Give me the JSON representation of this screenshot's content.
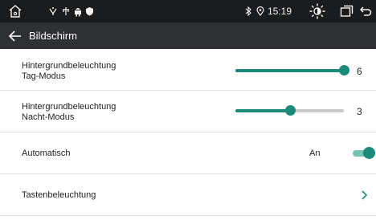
{
  "status_bar": {
    "time": "15:19",
    "icons": [
      "home-icon",
      "usb-icon",
      "gps-icon",
      "android-icon",
      "shield-icon",
      "bluetooth-icon",
      "location-icon",
      "brightness-icon",
      "recent-apps-icon",
      "back-icon"
    ]
  },
  "header": {
    "title": "Bildschirm"
  },
  "settings": {
    "day_backlight": {
      "label_line1": "Hintergrundbeleuchtung",
      "label_line2": "Tag-Modus",
      "value": "6",
      "level": 1.0
    },
    "night_backlight": {
      "label_line1": "Hintergrundbeleuchtung",
      "label_line2": "Nacht-Modus",
      "value": "3",
      "level": 0.5
    },
    "automatic": {
      "label": "Automatisch",
      "state_label": "An",
      "on": true
    },
    "key_lighting": {
      "label": "Tastenbeleuchtung"
    }
  },
  "colors": {
    "accent": "#1c8a7a",
    "status_bar_bg": "#1b1c1e",
    "title_bar_bg": "#2e3033"
  }
}
